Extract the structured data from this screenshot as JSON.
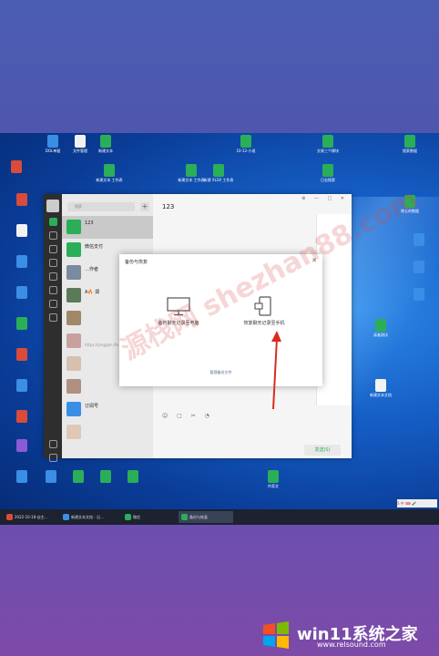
{
  "dialog": {
    "title": "备份与恢复",
    "option_backup": "备份聊天记录至电脑",
    "option_restore": "恢复聊天记录至手机",
    "manage_link": "管理备份文件"
  },
  "wechat": {
    "chat_title": "123",
    "search_placeholder": "搜索",
    "plus": "+",
    "send_label": "发送(S)",
    "window_buttons": "⊕ — □ ✕",
    "chats": [
      {
        "name": "123",
        "preview": "",
        "time": ""
      },
      {
        "name": "微信支付",
        "preview": "",
        "time": ""
      },
      {
        "name": "…作者",
        "preview": "",
        "time": ""
      },
      {
        "name": "A🔥 郑",
        "preview": "",
        "time": ""
      },
      {
        "name": "",
        "preview": "",
        "time": ""
      },
      {
        "name": "",
        "preview": "https://pinggan.fm",
        "time": ""
      },
      {
        "name": "",
        "preview": "",
        "time": ""
      },
      {
        "name": "",
        "preview": "",
        "time": ""
      },
      {
        "name": "订阅号",
        "preview": "",
        "time": ""
      },
      {
        "name": "",
        "preview": "",
        "time": ""
      }
    ]
  },
  "taskbar": {
    "items": [
      {
        "label": "2022-10-18-自主…"
      },
      {
        "label": "新建文本文档 - 记…"
      },
      {
        "label": "微信"
      },
      {
        "label": "备份与恢复"
      }
    ],
    "tray": "S 中 ⌨ 🎤"
  },
  "desktop_icons": [
    {
      "label": "DOL单据"
    },
    {
      "label": "文件管理"
    },
    {
      "label": "新建文本"
    },
    {
      "label": "10-12-小说"
    },
    {
      "label": "交易三个模块"
    },
    {
      "label": "搜索数据"
    },
    {
      "label": "新建文本 工作表"
    },
    {
      "label": "新建文本 工作表"
    },
    {
      "label": "新建 XLSX 工作表"
    },
    {
      "label": "日志搜索"
    },
    {
      "label": "增长的数据"
    },
    {
      "label": "新建文本文档"
    },
    {
      "label": "读者测试"
    },
    {
      "label": "电商平台"
    },
    {
      "label": "微信数据"
    },
    {
      "label": "作家文"
    }
  ],
  "watermark": "源栈网 shezhan88.com",
  "footer": {
    "brand": "win11系统之家",
    "url": "www.relsound.com"
  }
}
